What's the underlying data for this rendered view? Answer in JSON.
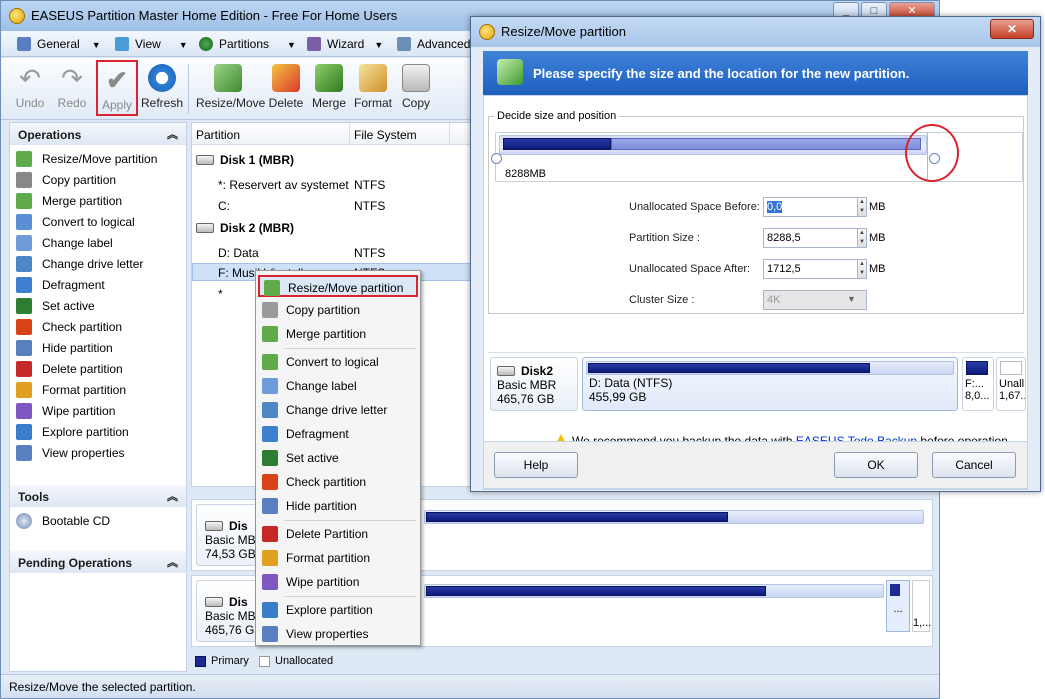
{
  "main": {
    "title": "EASEUS Partition Master Home Edition - Free For Home Users",
    "win_min": "_",
    "win_max": "□",
    "win_close": "✕"
  },
  "menubar": [
    {
      "label": "General"
    },
    {
      "label": "View"
    },
    {
      "label": "Partitions"
    },
    {
      "label": "Wizard"
    },
    {
      "label": "Advanced"
    }
  ],
  "toolbar": {
    "undo": "Undo",
    "redo": "Redo",
    "apply": "Apply",
    "refresh": "Refresh",
    "resize_move": "Resize/Move",
    "delete": "Delete",
    "merge": "Merge",
    "format": "Format",
    "copy": "Copy"
  },
  "operations": {
    "header": "Operations",
    "items": [
      "Resize/Move partition",
      "Copy partition",
      "Merge partition",
      "Convert to logical",
      "Change label",
      "Change drive letter",
      "Defragment",
      "Set active",
      "Check partition",
      "Hide partition",
      "Delete partition",
      "Format partition",
      "Wipe partition",
      "Explore partition",
      "View properties"
    ]
  },
  "tools": {
    "header": "Tools",
    "items": [
      "Bootable CD"
    ]
  },
  "pending": {
    "header": "Pending Operations"
  },
  "partition_list": {
    "columns": [
      "Partition",
      "File System"
    ],
    "disk1": "Disk 1 (MBR)",
    "disk1_rows": [
      {
        "name": "*: Reservert av systemet",
        "fs": "NTFS"
      },
      {
        "name": "C:",
        "fs": "NTFS"
      }
    ],
    "disk2": "Disk 2 (MBR)",
    "disk2_rows": [
      {
        "name": "D: Data",
        "fs": "NTFS"
      },
      {
        "name": "F: Musikk/install",
        "fs": "NTFS"
      },
      {
        "name": "*",
        "fs": ""
      }
    ]
  },
  "disk_maps": [
    {
      "name": "Dis",
      "type": "Basic MBR",
      "size": "74,53 GB"
    },
    {
      "name": "Dis",
      "type": "Basic MBR",
      "size": "465,76 GB",
      "small1": "...",
      "small2": "1,..."
    }
  ],
  "legend": {
    "primary": "Primary",
    "unallocated": "Unallocated"
  },
  "status": "Resize/Move the selected partition.",
  "context_menu": [
    "Resize/Move partition",
    "Copy partition",
    "Merge partition",
    "Convert to logical",
    "Change label",
    "Change drive letter",
    "Defragment",
    "Set active",
    "Check partition",
    "Hide partition",
    "Delete Partition",
    "Format partition",
    "Wipe partition",
    "Explore partition",
    "View properties"
  ],
  "dialog": {
    "title": "Resize/Move partition",
    "close": "✕",
    "banner": "Please specify the size and the location for the new partition.",
    "group_label": "Decide size and position",
    "bar_size": "8288MB",
    "fields": {
      "before_label": "Unallocated Space Before:",
      "before_value": "0,0",
      "size_label": "Partition Size :",
      "size_value": "8288,5",
      "after_label": "Unallocated Space After:",
      "after_value": "1712,5",
      "cluster_label": "Cluster Size :",
      "cluster_value": "4K",
      "unit": "MB"
    },
    "disk": {
      "name": "Disk2",
      "type": "Basic MBR",
      "size": "465,76 GB",
      "part_label": "D: Data (NTFS)",
      "part_size": "455,99 GB",
      "small1": "F:...",
      "small1b": "8,0...",
      "small2": "Unall...",
      "small2b": "1,67..."
    },
    "warning_pre": "We recommend you backup the data with ",
    "warning_link": "EASEUS Todo Backup",
    "warning_post": " before operation.",
    "help": "Help",
    "ok": "OK",
    "cancel": "Cancel"
  }
}
